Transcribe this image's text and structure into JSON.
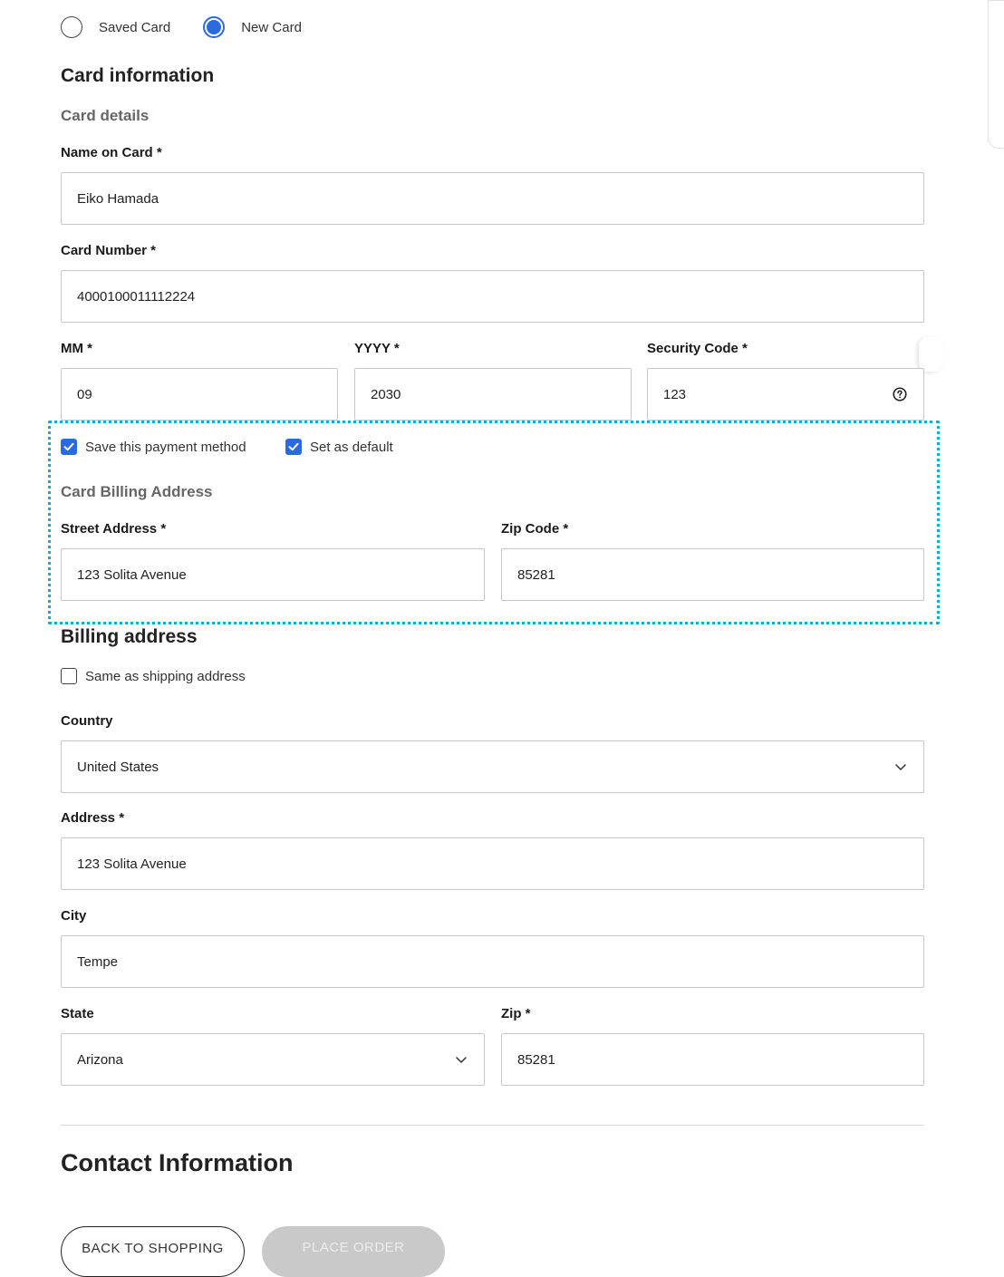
{
  "payment_choice": {
    "options": [
      {
        "label": "Saved Card",
        "selected": false
      },
      {
        "label": "New Card",
        "selected": true
      }
    ]
  },
  "card_info": {
    "title": "Card information",
    "subtitle": "Card details",
    "name_label": "Name on Card *",
    "name_value": "Eiko Hamada",
    "number_label": "Card Number *",
    "number_value": "4000100011112224",
    "mm_label": "MM *",
    "mm_value": "09",
    "yyyy_label": "YYYY *",
    "yyyy_value": "2030",
    "cvv_label": "Security Code *",
    "cvv_value": "123",
    "cvv_icon": "help-circle-icon"
  },
  "card_options": {
    "save_label": "Save this payment method",
    "save_checked": true,
    "default_label": "Set as default",
    "default_checked": true
  },
  "card_billing": {
    "title": "Card Billing Address",
    "street_label": "Street Address *",
    "street_value": "123 Solita Avenue",
    "zip_label": "Zip Code *",
    "zip_value": "85281"
  },
  "billing": {
    "title": "Billing address",
    "same_label": "Same as shipping address",
    "same_checked": false,
    "country_label": "Country",
    "country_value": "United States",
    "address_label": "Address *",
    "address_value": "123 Solita Avenue",
    "city_label": "City",
    "city_value": "Tempe",
    "state_label": "State",
    "state_value": "Arizona",
    "zip_label": "Zip *",
    "zip_value": "85281"
  },
  "contact": {
    "title": "Contact Information"
  },
  "actions": {
    "back_label": "BACK TO SHOPPING",
    "place_label": "PLACE ORDER"
  },
  "colors": {
    "accent": "#2a6ae0",
    "highlight_border": "#1aa7d6",
    "disabled_button": "#c9c9c9"
  }
}
